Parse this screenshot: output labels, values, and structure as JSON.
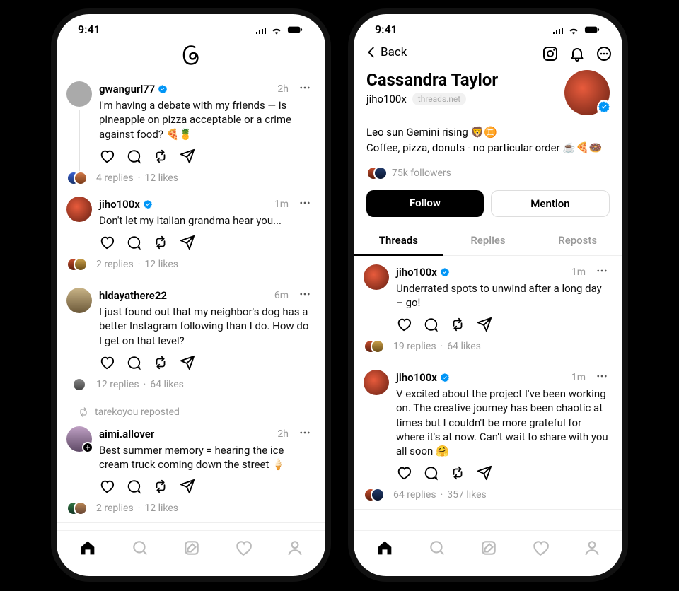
{
  "status": {
    "time": "9:41"
  },
  "feed": {
    "posts": [
      {
        "user": "gwangurl77",
        "verified": true,
        "time": "2h",
        "text": "I'm having a debate with my friends — is pineapple on pizza acceptable or a crime against food? 🍕🍍",
        "replies": "4 replies",
        "likes": "12 likes",
        "avatar_bg": "radial-gradient(circle at 40% 40%, #d4423a, #6b1a14)",
        "threaded": true
      },
      {
        "user": "jiho100x",
        "verified": true,
        "time": "1m",
        "text": "Don't let my Italian grandma hear you...",
        "replies": "2 replies",
        "likes": "12 likes",
        "avatar_bg": "radial-gradient(circle at 40% 40%, #e85b3c, #641f12)",
        "threaded": false
      },
      {
        "user": "hidayathere22",
        "verified": false,
        "time": "6m",
        "text": "I just found out that my neighbor's dog has a better Instagram following than I do. How do I get on that level?",
        "replies": "12 replies",
        "likes": "64 likes",
        "avatar_bg": "linear-gradient(#c9b487,#6b5838)",
        "single_replier": true
      },
      {
        "reposted_by": "tarekoyou reposted",
        "user": "aimi.allover",
        "verified": false,
        "time": "2h",
        "text": "Best summer memory = hearing the ice cream truck coming down the street 🍦",
        "replies": "2 replies",
        "likes": "12 likes",
        "avatar_bg": "linear-gradient(#bfa0c4,#5f4a66)",
        "follow_badge": true
      }
    ]
  },
  "profile": {
    "back_label": "Back",
    "name": "Cassandra Taylor",
    "handle": "jiho100x",
    "domain": "threads.net",
    "bio_line1": "Leo sun Gemini rising 🦁♊️",
    "bio_line2": "Coffee, pizza, donuts - no particular order ☕🍕🍩",
    "followers": "75k followers",
    "follow_btn": "Follow",
    "mention_btn": "Mention",
    "tabs": {
      "threads": "Threads",
      "replies": "Replies",
      "reposts": "Reposts"
    },
    "posts": [
      {
        "user": "jiho100x",
        "verified": true,
        "time": "1m",
        "text": "Underrated spots to unwind after a long day – go!",
        "replies": "19 replies",
        "likes": "64 likes"
      },
      {
        "user": "jiho100x",
        "verified": true,
        "time": "1m",
        "text": "V excited about the project I've been working on. The creative journey has been chaotic at times but I couldn't be more grateful for where it's at now. Can't wait to share with you all soon 🤗",
        "replies": "64 replies",
        "likes": "357 likes"
      }
    ]
  }
}
